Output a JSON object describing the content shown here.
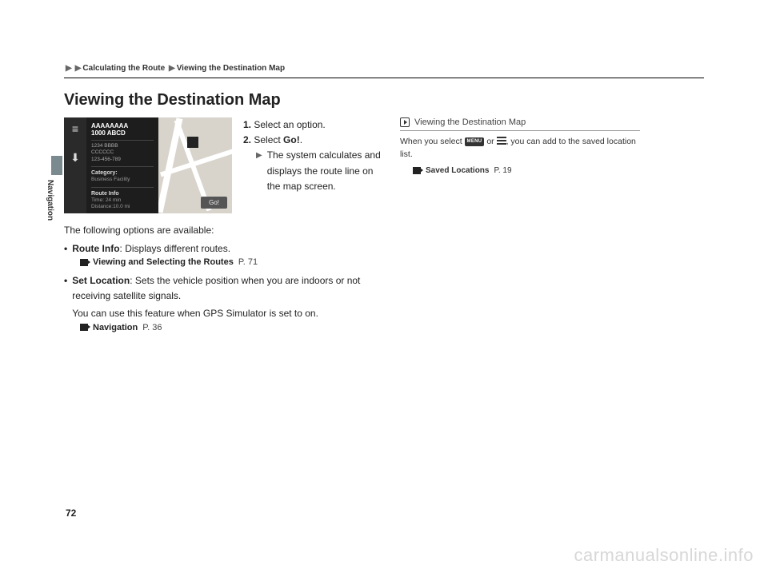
{
  "breadcrumb": {
    "level1": "Calculating the Route",
    "level2": "Viewing the Destination Map"
  },
  "section_title": "Viewing the Destination Map",
  "side_label": "Navigation",
  "screenshot": {
    "title_line1": "AAAAAAAA",
    "title_line2": "1000 ABCD",
    "address_line1": "1234 BBBB",
    "address_line2": "CCCCCC",
    "address_line3": "123-456-789",
    "category_label": "Category:",
    "category_value": "Business Facility",
    "routeinfo_label": "Route Info",
    "routeinfo_time": "Time: 24 min",
    "routeinfo_distance": "Distance:10.0 mi",
    "go_button": "Go!"
  },
  "steps": {
    "s1_num": "1.",
    "s1_text": "Select an option.",
    "s2_num": "2.",
    "s2_pre": "Select ",
    "s2_bold": "Go!",
    "s2_post": ".",
    "s2_sub": "The system calculates and displays the route line on the map screen."
  },
  "body": {
    "intro": "The following options are available:",
    "bullet1_bold": "Route Info",
    "bullet1_rest": ": Displays different routes.",
    "xref1_bold": "Viewing and Selecting the Routes",
    "xref1_page": "P. 71",
    "bullet2_bold": "Set Location",
    "bullet2_rest": ": Sets the vehicle position when you are indoors or not receiving satellite signals.",
    "bullet2_line2": "You can use this feature when GPS Simulator is set to on.",
    "xref2_bold": "Navigation",
    "xref2_page": "P. 36"
  },
  "info": {
    "header": "Viewing the Destination Map",
    "text_pre": "When you select ",
    "menu_label": "MENU",
    "text_mid": " or ",
    "text_post": ", you can add to the saved location list.",
    "xref_bold": "Saved Locations",
    "xref_page": "P. 19"
  },
  "page_number": "72",
  "watermark": "carmanualsonline.info"
}
